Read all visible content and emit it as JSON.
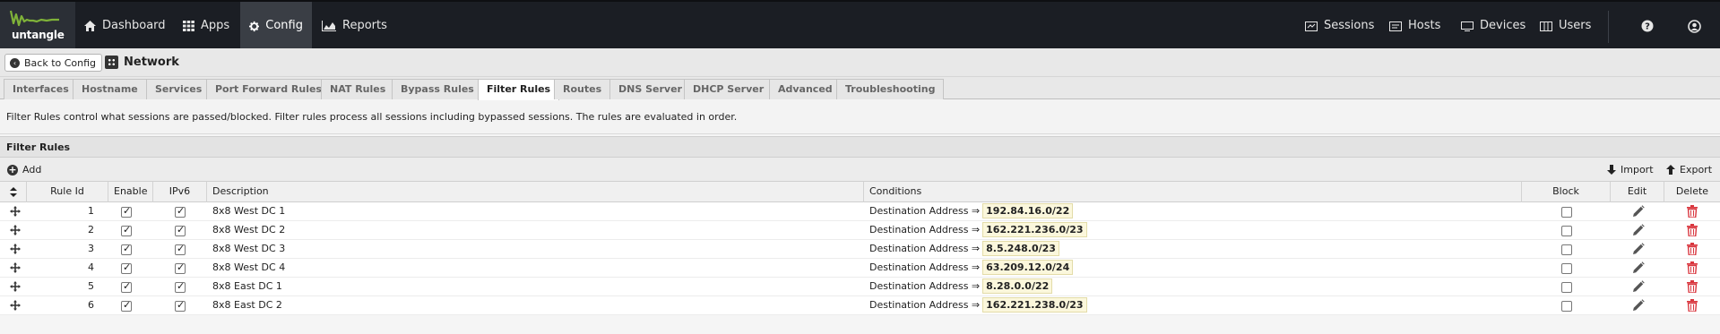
{
  "nav": {
    "logo_text": "untangle",
    "left": [
      {
        "label": "Dashboard",
        "icon": "home-icon",
        "active": false
      },
      {
        "label": "Apps",
        "icon": "grid-icon",
        "active": false
      },
      {
        "label": "Config",
        "icon": "gear-icon",
        "active": true
      },
      {
        "label": "Reports",
        "icon": "chart-icon",
        "active": false
      }
    ],
    "right": [
      {
        "label": "Sessions",
        "icon": "sessions-icon"
      },
      {
        "label": "Hosts",
        "icon": "hosts-icon"
      },
      {
        "label": "Devices",
        "icon": "devices-icon"
      },
      {
        "label": "Users",
        "icon": "users-icon"
      }
    ]
  },
  "breadcrumb": {
    "back_label": "Back to Config",
    "title": "Network"
  },
  "tabs": [
    "Interfaces",
    "Hostname",
    "Services",
    "Port Forward Rules",
    "NAT Rules",
    "Bypass Rules",
    "Filter Rules",
    "Routes",
    "DNS Server",
    "DHCP Server",
    "Advanced",
    "Troubleshooting"
  ],
  "active_tab": "Filter Rules",
  "description": "Filter Rules control what sessions are passed/blocked. Filter rules process all sessions including bypassed sessions. The rules are evaluated in order.",
  "panel": {
    "title": "Filter Rules",
    "add_label": "Add",
    "import_label": "Import",
    "export_label": "Export"
  },
  "columns": {
    "rule_id": "Rule Id",
    "enable": "Enable",
    "ipv6": "IPv6",
    "description": "Description",
    "conditions": "Conditions",
    "block": "Block",
    "edit": "Edit",
    "delete": "Delete"
  },
  "condition_prefix": "Destination Address ⇒",
  "rows": [
    {
      "id": "1",
      "enable": true,
      "ipv6": true,
      "description": "8x8 West DC 1",
      "address": "192.84.16.0/22",
      "block": false
    },
    {
      "id": "2",
      "enable": true,
      "ipv6": true,
      "description": "8x8 West DC 2",
      "address": "162.221.236.0/23",
      "block": false
    },
    {
      "id": "3",
      "enable": true,
      "ipv6": true,
      "description": "8x8 West DC 3",
      "address": "8.5.248.0/23",
      "block": false
    },
    {
      "id": "4",
      "enable": true,
      "ipv6": true,
      "description": "8x8 West DC 4",
      "address": "63.209.12.0/24",
      "block": false
    },
    {
      "id": "5",
      "enable": true,
      "ipv6": true,
      "description": "8x8 East DC 1",
      "address": "8.28.0.0/22",
      "block": false
    },
    {
      "id": "6",
      "enable": true,
      "ipv6": true,
      "description": "8x8 East DC 2",
      "address": "162.221.238.0/23",
      "block": false
    }
  ],
  "colors": {
    "topbar": "#1b1e24",
    "logo_green": "#7fb239",
    "delete_red": "#d9363e"
  }
}
